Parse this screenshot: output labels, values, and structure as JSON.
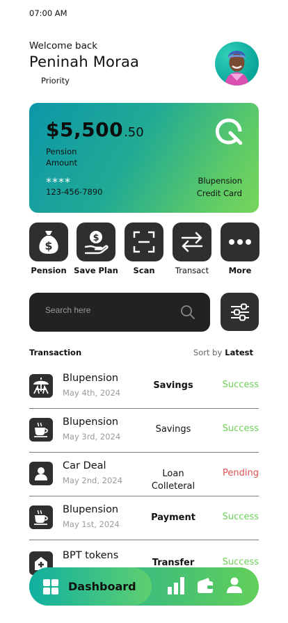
{
  "status_bar": {
    "time": "07:00 AM"
  },
  "header": {
    "greeting": "Welcome back",
    "name": "Peninah Moraa",
    "tier": "Priority"
  },
  "card": {
    "amount_main": "$5,500",
    "amount_cents": ".50",
    "amount_label": "Pension Amount",
    "masked": "****",
    "number": "123-456-7890",
    "brand_line1": "Blupension",
    "brand_line2": "Credit Card",
    "gradient_colors": [
      "#0d97a8",
      "#79d65a"
    ]
  },
  "actions": [
    {
      "label": "Pension",
      "icon": "money-bag-icon"
    },
    {
      "label": "Save Plan",
      "icon": "hand-dollar-icon"
    },
    {
      "label": "Scan",
      "icon": "scan-frame-icon"
    },
    {
      "label": "Transact",
      "icon": "transfer-arrows-icon"
    },
    {
      "label": "More",
      "icon": "more-dots-icon"
    }
  ],
  "search": {
    "placeholder": "Search here",
    "icon": "search-icon"
  },
  "filter": {
    "icon": "sliders-icon"
  },
  "transactions_header": {
    "title": "Transaction",
    "sort_label": "Sort by",
    "sort_value": "Latest"
  },
  "transactions": [
    {
      "name": "Blupension",
      "date": "May 4th, 2024",
      "type": "Savings",
      "status": "Success",
      "icon": "umbrella-icon"
    },
    {
      "name": "Blupension",
      "date": "May 3rd, 2024",
      "type": "Savings",
      "status": "Success",
      "icon": "coffee-cup-icon"
    },
    {
      "name": "Car Deal",
      "date": "May 2nd, 2024",
      "type": "Loan Colleteral",
      "type_line1": "Loan",
      "type_line2": "Colleteral",
      "status": "Pending",
      "icon": "user-icon"
    },
    {
      "name": "Blupension",
      "date": "May 1st, 2024",
      "type": "Payment",
      "status": "Success",
      "icon": "coffee-cup-icon"
    },
    {
      "name": "BPT tokens",
      "date": "",
      "type": "Transfer",
      "status": "Success",
      "icon": "hospital-icon"
    }
  ],
  "colors": {
    "success": "#6ccf57",
    "pending": "#e05050",
    "tile": "#2f2f2f"
  },
  "nav": {
    "dashboard_label": "Dashboard",
    "icons": [
      "dashboard-grid-icon",
      "bar-chart-icon",
      "wallet-icon",
      "profile-icon"
    ]
  }
}
